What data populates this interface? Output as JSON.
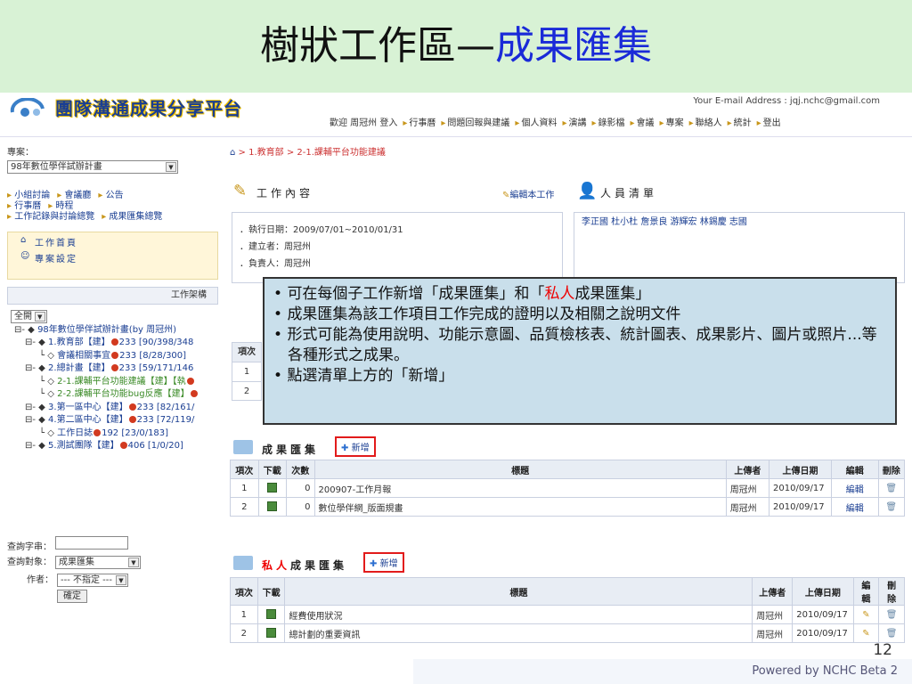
{
  "slide": {
    "title_main": "樹狀工作區—",
    "title_accent": "成果匯集",
    "page_number": "12",
    "powered_by": "Powered by NCHC Beta 2"
  },
  "header": {
    "logo_text": "團隊溝通成果分享平台",
    "email": "Your E-mail Address : jqj.nchc@gmail.com",
    "nav": [
      "歡迎 周冠州 登入",
      "行事曆",
      "問題回報與建議",
      "個人資料",
      "演講",
      "錄影檔",
      "會議",
      "專案",
      "聯絡人",
      "統計",
      "登出"
    ]
  },
  "left": {
    "project_label": "專案：",
    "project_value": "98年數位學伴試辦計畫",
    "links_row1": [
      "小組討論",
      "會議廳",
      "公告"
    ],
    "links_row2": [
      "行事曆",
      "時程"
    ],
    "links_row3": [
      "工作記錄與討論總覽",
      "成果匯集總覽"
    ],
    "menu": [
      "工作首頁",
      "專案設定"
    ],
    "tree_header": "工作架構",
    "expand_value": "全開",
    "tree_root": "98年數位學伴試辦計畫(by 周冠州)",
    "tree": [
      {
        "label": "1.教育部【建】",
        "stat": "233 [90/398/348",
        "indent": 1,
        "cls": "blue"
      },
      {
        "label": "會議相關事宜",
        "stat": "233 [8/28/300]",
        "indent": 2,
        "cls": "blue"
      },
      {
        "label": "2.總計畫【建】",
        "stat": "233 [59/171/146",
        "indent": 1,
        "cls": "blue"
      },
      {
        "label": "2-1.課輔平台功能建議【建】【執",
        "stat": "",
        "indent": 2,
        "cls": "green"
      },
      {
        "label": "2-2.課輔平台功能bug反應【建】",
        "stat": "",
        "indent": 2,
        "cls": "green"
      },
      {
        "label": "3.第一區中心【建】",
        "stat": "233 [82/161/",
        "indent": 1,
        "cls": "blue"
      },
      {
        "label": "4.第二區中心【建】",
        "stat": "233 [72/119/",
        "indent": 1,
        "cls": "blue"
      },
      {
        "label": "工作日誌",
        "stat": "192 [23/0/183]",
        "indent": 2,
        "cls": "blue"
      },
      {
        "label": "5.測試團隊【建】",
        "stat": "406 [1/0/20]",
        "indent": 1,
        "cls": "blue"
      }
    ],
    "query_label": "查詢字串：",
    "target_label": "查詢對象：",
    "target_value": "成果匯集",
    "author_label": "作者：",
    "author_value": "--- 不指定 ---",
    "ok_button": "確定"
  },
  "main": {
    "breadcrumb": "> 1.教育部 > 2-1.課輔平台功能建議",
    "work_title": "工作內容",
    "edit_work": "編輯本工作",
    "staff_title": "人員清單",
    "work_info": [
      "．執行日期：2009/07/01~2010/01/31",
      "．建立者：周冠州",
      "．負責人：周冠州"
    ],
    "staff": "李正國 杜小杜 詹景良 游輝宏 林錫慶 志國",
    "mid_rows": [
      "1",
      "2"
    ],
    "results_title": "成果匯集",
    "add_label": "新增",
    "results_headers": [
      "項次",
      "下載",
      "次數",
      "標題",
      "上傳者",
      "上傳日期",
      "編輯",
      "刪除"
    ],
    "results_rows": [
      {
        "no": "1",
        "count": "0",
        "title": "200907-工作月報",
        "uploader": "周冠州",
        "date": "2010/09/17",
        "edit": "編輯"
      },
      {
        "no": "2",
        "count": "0",
        "title": "數位學伴網_版面規畫",
        "uploader": "周冠州",
        "date": "2010/09/17",
        "edit": "編輯"
      }
    ],
    "private_title_red": "私人",
    "private_title": "成果匯集",
    "private_headers": [
      "項次",
      "下載",
      "標題",
      "上傳者",
      "上傳日期",
      "編輯",
      "刪除"
    ],
    "private_rows": [
      {
        "no": "1",
        "title": "經費使用狀況",
        "uploader": "周冠州",
        "date": "2010/09/17"
      },
      {
        "no": "2",
        "title": "總計劃的重要資訊",
        "uploader": "周冠州",
        "date": "2010/09/17"
      }
    ]
  },
  "callout": {
    "b1_pre": "可在每個子工作新增「成果匯集」和「",
    "b1_red": "私人",
    "b1_post": "成果匯集」",
    "b2": "成果匯集為該工作項目工作完成的證明以及相關之說明文件",
    "b3": "形式可能為使用說明、功能示意圖、品質檢核表、統計圖表、成果影片、圖片或照片...等各種形式之成果。",
    "b4": "點選清單上方的「新增」"
  }
}
